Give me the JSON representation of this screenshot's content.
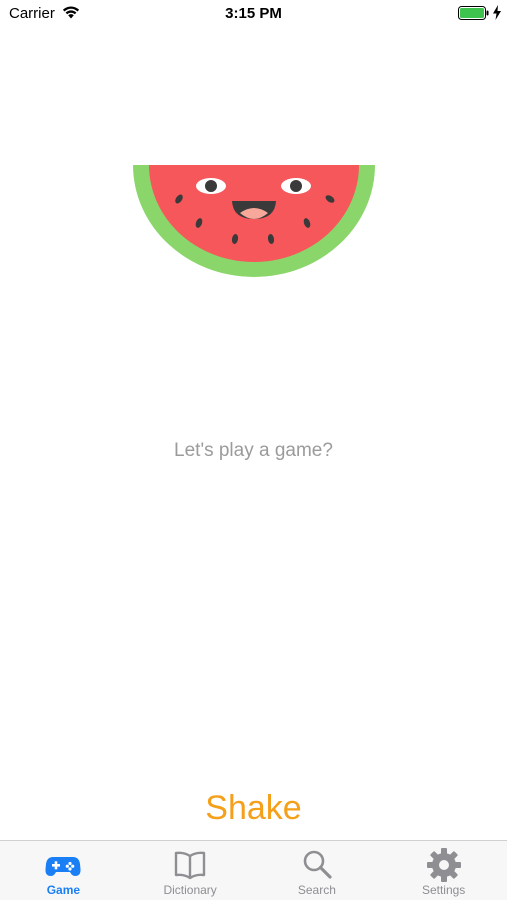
{
  "status_bar": {
    "carrier": "Carrier",
    "time": "3:15 PM",
    "battery_level": 1.0
  },
  "main": {
    "prompt": "Let's play a game?",
    "shake_label": "Shake"
  },
  "tab_bar": {
    "active_index": 0,
    "tabs": [
      {
        "label": "Game",
        "icon": "gamepad-icon"
      },
      {
        "label": "Dictionary",
        "icon": "book-icon"
      },
      {
        "label": "Search",
        "icon": "search-icon"
      },
      {
        "label": "Settings",
        "icon": "gear-icon"
      }
    ]
  },
  "colors": {
    "accent": "#1a7ff5",
    "shake": "#f5a01a",
    "inactive_tab": "#8e8e93",
    "prompt_text": "#9b9b9b",
    "melon_rind": "#8bd66b",
    "melon_flesh": "#f5575b",
    "battery": "#3ec34f"
  }
}
